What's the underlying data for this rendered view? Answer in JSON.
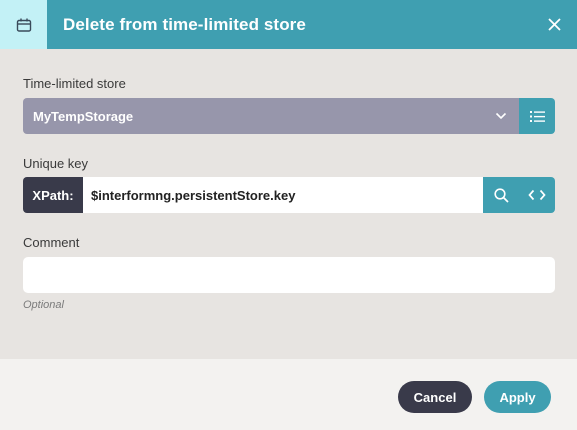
{
  "dialog": {
    "title": "Delete from time-limited store",
    "icon": "calendar-icon",
    "close_icon": "close-icon"
  },
  "store": {
    "label": "Time-limited store",
    "selected": "MyTempStorage",
    "dropdown_icon": "chevron-down-icon",
    "list_icon": "list-icon"
  },
  "key": {
    "label": "Unique key",
    "prefix": "XPath:",
    "value": "$interformng.persistentStore.key",
    "search_icon": "search-icon",
    "code_icon": "code-icon"
  },
  "comment": {
    "label": "Comment",
    "value": "",
    "hint": "Optional"
  },
  "actions": {
    "cancel": "Cancel",
    "apply": "Apply"
  },
  "colors": {
    "header": "#3f9fb1",
    "header_icon_bg": "#c3f1f6",
    "select_bg": "#9796ab",
    "dark": "#393a4a",
    "body_bg": "#e7e4e1",
    "footer_bg": "#f3f2f0"
  }
}
